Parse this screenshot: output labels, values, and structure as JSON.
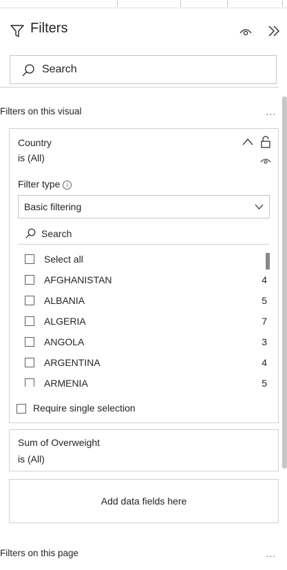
{
  "header": {
    "title": "Filters"
  },
  "search": {
    "placeholder": "Search"
  },
  "visual_section": {
    "label": "Filters on this visual",
    "more": "..."
  },
  "country_card": {
    "field": "Country",
    "condition": "is (All)",
    "filter_type_label": "Filter type",
    "filter_type_value": "Basic filtering",
    "list_search_placeholder": "Search",
    "items": [
      {
        "label": "Select all",
        "count": ""
      },
      {
        "label": "AFGHANISTAN",
        "count": "4"
      },
      {
        "label": "ALBANIA",
        "count": "5"
      },
      {
        "label": "ALGERIA",
        "count": "7"
      },
      {
        "label": "ANGOLA",
        "count": "3"
      },
      {
        "label": "ARGENTINA",
        "count": "4"
      },
      {
        "label": "ARMENIA",
        "count": "5"
      }
    ],
    "require_single": "Require single selection"
  },
  "sum_card": {
    "field": "Sum of Overweight",
    "condition": "is (All)"
  },
  "add_fields": {
    "label": "Add data fields here"
  },
  "page_section": {
    "label": "Filters on this page",
    "more": "..."
  },
  "colors": {
    "border": "#d2d0ce",
    "text": "#252423",
    "scrollbar": "#c8c6c4"
  },
  "icons": [
    "filter-icon",
    "eye-icon",
    "collapse-icon",
    "search-icon",
    "caret-up-icon",
    "lock-icon",
    "info-icon",
    "chevron-down-icon"
  ]
}
